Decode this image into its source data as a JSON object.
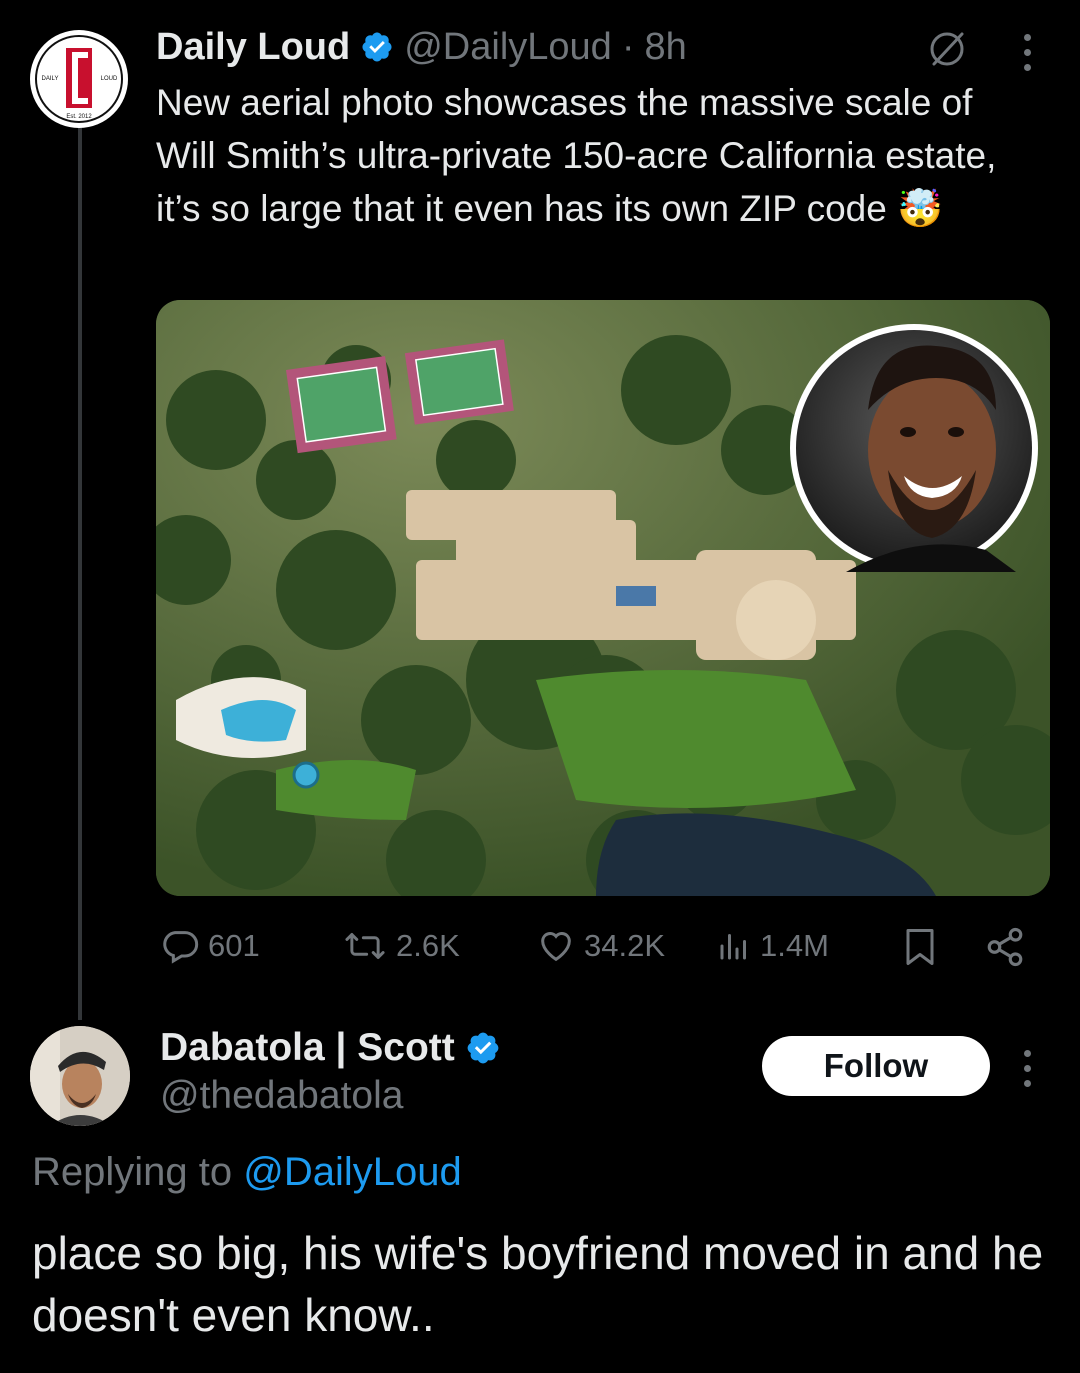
{
  "tweet": {
    "author_name": "Daily Loud",
    "author_handle": "@DailyLoud",
    "separator": "·",
    "time": "8h",
    "avatar_logo": {
      "top": "DAILY",
      "right": "LOUD",
      "bottom": "Est. 2012"
    },
    "text": "New aerial photo showcases the massive scale of Will Smith’s ultra-private 150-acre California estate, it’s so large that it even has its own ZIP code 🤯",
    "verified": true,
    "stats": {
      "replies": "601",
      "retweets": "2.6K",
      "likes": "34.2K",
      "views": "1.4M"
    }
  },
  "reply": {
    "author_name": "Dabatola | Scott",
    "author_handle": "@thedabatola",
    "verified": true,
    "follow_label": "Follow",
    "replying_prefix": "Replying to",
    "replying_to": "@DailyLoud",
    "text": "place so big, his wife's boyfriend moved in and he doesn't even know.."
  },
  "colors": {
    "background": "#000000",
    "text": "#e7e9ea",
    "muted": "#71767b",
    "link": "#1d9bf0",
    "verified": "#1d9bf0",
    "logo_red": "#c8102e"
  },
  "icons": [
    "grok-icon",
    "more-icon",
    "reply-icon",
    "retweet-icon",
    "like-icon",
    "views-icon",
    "bookmark-icon",
    "share-icon",
    "verified-badge-icon"
  ]
}
